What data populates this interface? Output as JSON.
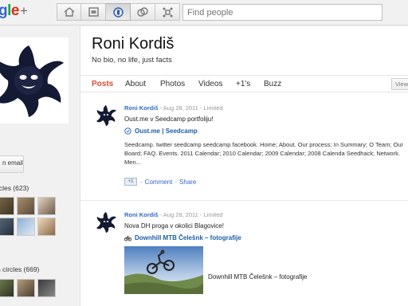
{
  "topbar": {
    "logo_letters": [
      "g",
      "l",
      "e"
    ],
    "logo_plus": "+",
    "nav_icons": [
      "home-icon",
      "photos-icon",
      "profile-icon",
      "circles-icon",
      "games-icon"
    ],
    "search_placeholder": "Find people"
  },
  "sidebar": {
    "email_button": "n email",
    "in_circles_label": "rcles (623)",
    "have_in_circles_label": "n circles (669)"
  },
  "profile": {
    "name": "Roni Kordiš",
    "bio": "No bio, no life, just facts"
  },
  "tabs": [
    {
      "label": "Posts",
      "active": true
    },
    {
      "label": "About"
    },
    {
      "label": "Photos"
    },
    {
      "label": "Videos"
    },
    {
      "label": "+1's"
    },
    {
      "label": "Buzz"
    }
  ],
  "view_button": "View",
  "posts": [
    {
      "author": "Roni Kordiš",
      "date": "Aug 28, 2011",
      "visibility": "Limited",
      "text": "Oust.me v Seedcamp portfoliju!",
      "link_title": "Oust.me | Seedcamp",
      "snippet": "Seedcamp. twitter seedcamp seedcamp facebook. Home; About. Our process; In Summary; O Team; Our Board; FAQ. Events. 2011 Calendar; 2010 Calendar; 2009 Calendar; 2008 Calenda Seedhack; Network. Men...",
      "plus_one": "+1",
      "comment_label": "Comment",
      "share_label": "Share"
    },
    {
      "author": "Roni Kordiš",
      "date": "Aug 28, 2011",
      "visibility": "Limited",
      "text": "Nova DH proga v okolici Blagovice!",
      "link_title": "Downhill MTB Čelešnk – fotografije",
      "photo_caption": "Downhill MTB Čelešnk – fotografije"
    }
  ],
  "separator": " - ",
  "colors": {
    "accent_red": "#dd4b39",
    "link_blue": "#3366cc"
  }
}
